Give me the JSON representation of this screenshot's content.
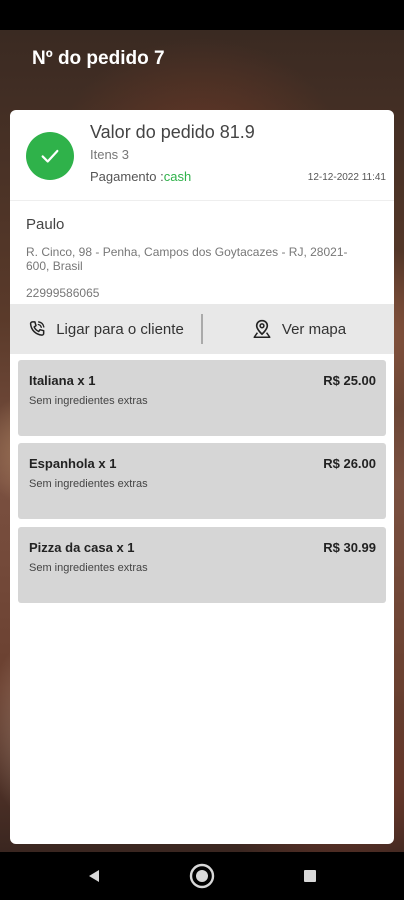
{
  "header": {
    "title": "Nº do pedido 7"
  },
  "summary": {
    "order_value": "Valor do pedido 81.9",
    "items_count": "Itens 3",
    "payment_label": "Pagamento :",
    "payment_method": "cash",
    "timestamp": "12-12-2022 11:41",
    "status_icon": "check-icon",
    "status_color": "#2fb24a"
  },
  "customer": {
    "name": "Paulo",
    "address": "R. Cinco, 98 - Penha, Campos dos Goytacazes - RJ, 28021-600, Brasil",
    "phone": "22999586065"
  },
  "actions": {
    "call_label": "Ligar para o cliente",
    "call_icon": "phone-call-icon",
    "map_label": "Ver mapa",
    "map_icon": "map-pin-icon"
  },
  "items": [
    {
      "name": "Italiana x 1",
      "price": "R$ 25.00",
      "extras": "Sem ingredientes extras"
    },
    {
      "name": "Espanhola x 1",
      "price": "R$ 26.00",
      "extras": "Sem ingredientes extras"
    },
    {
      "name": "Pizza da casa x 1",
      "price": "R$ 30.99",
      "extras": "Sem ingredientes extras"
    }
  ],
  "nav": {
    "back_icon": "back-triangle-icon",
    "home_icon": "home-circle-icon",
    "recents_icon": "recents-square-icon"
  }
}
